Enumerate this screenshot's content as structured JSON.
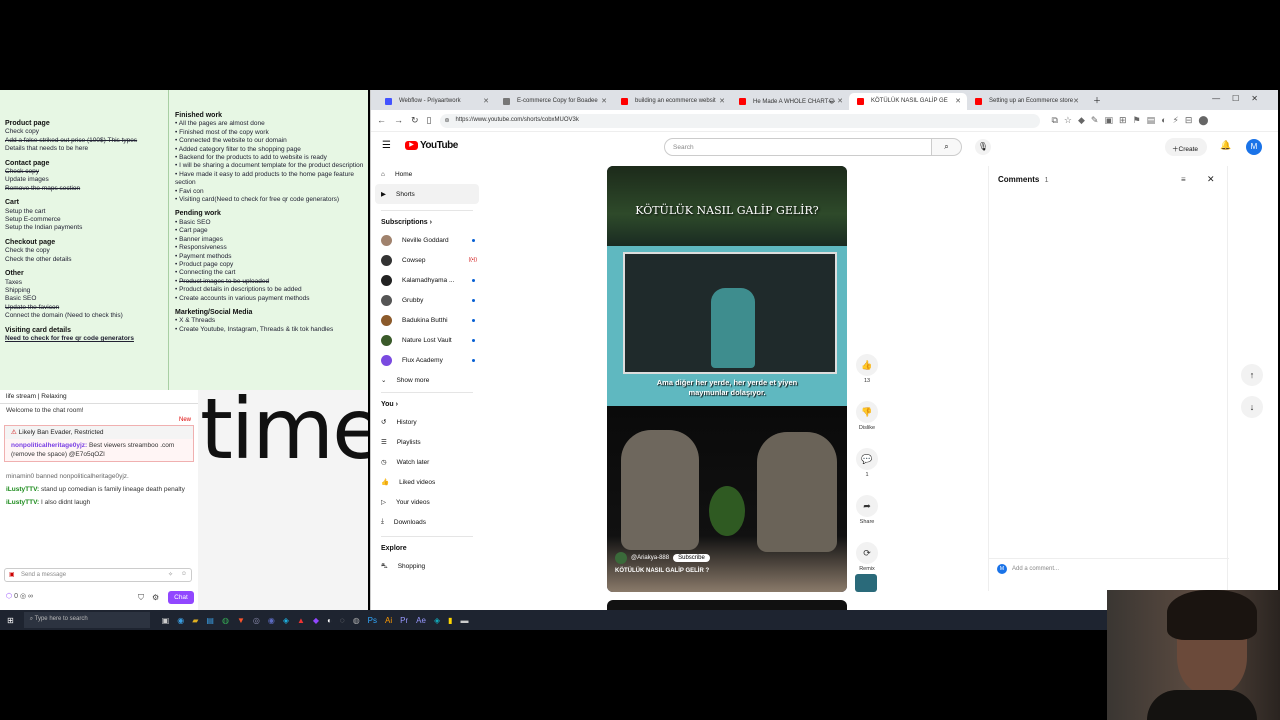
{
  "notes_left": {
    "sections": [
      {
        "heading": "Product page",
        "items": [
          {
            "text": "Check copy",
            "strike": false
          },
          {
            "text": "Add a false striked out price (100$) This types",
            "strike": true
          },
          {
            "text": "Details that needs to be here",
            "strike": false
          }
        ]
      },
      {
        "heading": "Contact page",
        "items": [
          {
            "text": "Check copy",
            "strike": true
          },
          {
            "text": "Update images",
            "strike": false
          },
          {
            "text": "Remove the maps section",
            "strike": true
          }
        ]
      },
      {
        "heading": "Cart",
        "items": [
          {
            "text": "Setup the cart",
            "strike": false
          },
          {
            "text": "Setup E-commerce",
            "strike": false
          },
          {
            "text": "Setup the Indian payments",
            "strike": false
          }
        ]
      },
      {
        "heading": "Checkout page",
        "items": [
          {
            "text": "Check the copy",
            "strike": false
          },
          {
            "text": "Check the other details",
            "strike": false
          }
        ]
      },
      {
        "heading": "Other",
        "items": [
          {
            "text": "Taxes",
            "strike": false
          },
          {
            "text": "Shipping",
            "strike": false
          },
          {
            "text": "Basic SEO",
            "strike": false
          },
          {
            "text": "Update the favicon",
            "strike": true
          },
          {
            "text": "Connect the domain (Need to check this)",
            "strike": false
          }
        ]
      },
      {
        "heading": "Visiting card details",
        "items": [
          {
            "text": "Need to check for free qr code generators",
            "strike": false,
            "under": true
          }
        ]
      }
    ]
  },
  "notes_right": {
    "sections": [
      {
        "heading": "Finished work",
        "items": [
          "All the pages are almost done",
          "Finished most of the copy work",
          "Connected the website to our domain",
          "Added category filter to the shopping page",
          "Backend for the products to add to website is ready",
          "I will be sharing a document template for the product description",
          "Have made it easy to add products to the home page feature section",
          "Favi con",
          "Visiting card(Need to check for free qr code generators)"
        ]
      },
      {
        "heading": "Pending work",
        "items": [
          "Basic SEO",
          "Cart page",
          "Banner images",
          "Responsiveness",
          "Payment methods",
          "Product page copy",
          "Connecting the cart",
          "Product images to be uploaded",
          "Product details in descriptions to be added",
          "Create accounts in various payment methods"
        ]
      },
      {
        "heading": "Marketing/Social Media",
        "items": [
          "X & Threads",
          "Create Youtube, Instagram, Threads & tik tok handles"
        ]
      }
    ]
  },
  "chat": {
    "stream_title": "life stream | Relaxing",
    "welcome": "Welcome to the chat room!",
    "new_label": "New",
    "banner": "Likely Ban Evader, Restricted",
    "messages": [
      {
        "user": "nonpoliticalheritage0yjz:",
        "text": "Best viewers streamboo .com (remove the space) @E7o5qOZl"
      },
      {
        "user": "",
        "text": "minamin0 banned nonpoliticalheritage0yjz."
      },
      {
        "user": "iLustyTTV:",
        "text": "stand up comedian is family lineage death penalty"
      },
      {
        "user": "iLustyTTV:",
        "text": "I also didnt laugh"
      }
    ],
    "input_placeholder": "Send a message",
    "chat_button": "Chat",
    "points": "0"
  },
  "desktop_word": "time",
  "browser": {
    "tabs": [
      {
        "title": "Webflow - Priyaartwork",
        "color": "#4353ff",
        "active": false
      },
      {
        "title": "E-commerce Copy for Boadee",
        "color": "#777",
        "active": false
      },
      {
        "title": "building an ecommerce websit",
        "color": "#ff0000",
        "active": false
      },
      {
        "title": "He Made A WHOLE CHART😂",
        "color": "#ff0000",
        "active": false
      },
      {
        "title": "KÖTÜLÜK NASIL GALİP GE",
        "color": "#ff0000",
        "active": true
      },
      {
        "title": "Setting up an Ecommerce store",
        "color": "#ff0000",
        "active": false
      }
    ],
    "url": "https://www.youtube.com/shorts/cobxMUOV3k"
  },
  "youtube": {
    "logo": "YouTube",
    "search_placeholder": "Search",
    "create_label": "Create",
    "avatar_letter": "M",
    "nav": [
      {
        "label": "Home",
        "icon": "home-icon"
      },
      {
        "label": "Shorts",
        "icon": "shorts-icon"
      }
    ],
    "subs_heading": "Subscriptions",
    "subs": [
      {
        "name": "Neville Goddard",
        "color": "#a0826d",
        "live": false
      },
      {
        "name": "Cowsep",
        "color": "#333",
        "live": true
      },
      {
        "name": "Kalamadhyama ...",
        "color": "#222",
        "live": false
      },
      {
        "name": "Grubby",
        "color": "#555",
        "live": false
      },
      {
        "name": "Badukina Butthi",
        "color": "#8b5a2b",
        "live": false
      },
      {
        "name": "Nature Lost Vault",
        "color": "#3a5a2a",
        "live": false
      },
      {
        "name": "Flux Academy",
        "color": "#7a4ae0",
        "live": false
      }
    ],
    "show_more": "Show more",
    "you_heading": "You",
    "you_items": [
      {
        "label": "History",
        "icon": "history-icon"
      },
      {
        "label": "Playlists",
        "icon": "playlists-icon"
      },
      {
        "label": "Watch later",
        "icon": "clock-icon"
      },
      {
        "label": "Liked videos",
        "icon": "thumbs-up-icon"
      },
      {
        "label": "Your videos",
        "icon": "video-icon"
      },
      {
        "label": "Downloads",
        "icon": "download-icon"
      }
    ],
    "explore_heading": "Explore",
    "explore_items": [
      {
        "label": "Shopping",
        "icon": "bag-icon"
      }
    ],
    "video": {
      "title_overlay": "KÖTÜLÜK NASIL GALİP GELİR?",
      "subtitle": "Ama diğer her yerde, her yerde et yiyen maymunlar dolaşıyor.",
      "channel": "@Ariakya-888",
      "subscribe": "Subscribe",
      "caption": "KÖTÜLÜK NASIL GALİP GELİR ?"
    },
    "actions": [
      {
        "label": "13",
        "icon": "thumbs-up-icon",
        "glyph": "👍"
      },
      {
        "label": "Dislike",
        "icon": "thumbs-down-icon",
        "glyph": "👎"
      },
      {
        "label": "1",
        "icon": "comment-icon",
        "glyph": "💬"
      },
      {
        "label": "Share",
        "icon": "share-icon",
        "glyph": "➦"
      },
      {
        "label": "Remix",
        "icon": "remix-icon",
        "glyph": "⟳"
      }
    ],
    "comments": {
      "title": "Comments",
      "count": "1",
      "add_placeholder": "Add a comment..."
    }
  },
  "taskbar": {
    "search_placeholder": "Type here to search"
  }
}
